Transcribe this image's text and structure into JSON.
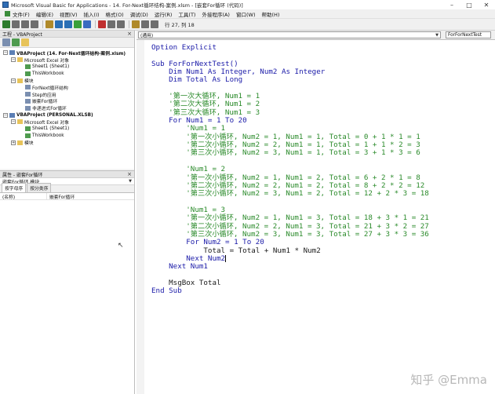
{
  "window": {
    "title": "Microsoft Visual Basic for Applications - 14. For-Next循环结构-案例.xlsm - [嵌套For循环 (代码)]",
    "minimize_glyph": "–",
    "maximize_glyph": "□",
    "close_glyph": "✕"
  },
  "menu": [
    "文件(F)",
    "编辑(E)",
    "视图(V)",
    "插入(I)",
    "格式(O)",
    "调试(D)",
    "运行(R)",
    "工具(T)",
    "外接程序(A)",
    "窗口(W)",
    "帮助(H)"
  ],
  "toolbar": {
    "position_text": "行 27, 列 18",
    "colors": [
      "#2d7c2d",
      "#6e6e6e",
      "#6e6e6e",
      "#6e6e6e",
      "#b08a2a",
      "#2a6fb5",
      "#2a6fb5",
      "#3aa03a",
      "#3a6bc0",
      "#c03030",
      "#6e6e6e",
      "#6e6e6e",
      "#b08a2a",
      "#6e6e6e",
      "#6e6e6e"
    ]
  },
  "project_panel": {
    "title": "工程 - VBAProject",
    "close_glyph": "×",
    "tree": [
      {
        "level": 0,
        "toggle": "−",
        "icon": "proj",
        "label": "VBAProject (14. For-Next循环结构-案例.xlsm)"
      },
      {
        "level": 1,
        "toggle": "−",
        "icon": "folder",
        "label": "Microsoft Excel 对象"
      },
      {
        "level": 2,
        "toggle": "",
        "icon": "sheet",
        "label": "Sheet1 (Sheet1)"
      },
      {
        "level": 2,
        "toggle": "",
        "icon": "sheet",
        "label": "ThisWorkbook"
      },
      {
        "level": 1,
        "toggle": "−",
        "icon": "folder",
        "label": "模块"
      },
      {
        "level": 2,
        "toggle": "",
        "icon": "module",
        "label": "ForNext循环结构"
      },
      {
        "level": 2,
        "toggle": "",
        "icon": "module",
        "label": "Step的应用"
      },
      {
        "level": 2,
        "toggle": "",
        "icon": "module",
        "label": "嵌套For循环"
      },
      {
        "level": 2,
        "toggle": "",
        "icon": "module",
        "label": "非递进式For循环"
      },
      {
        "level": 0,
        "toggle": "−",
        "icon": "proj",
        "label": "VBAProject (PERSONAL.XLSB)"
      },
      {
        "level": 1,
        "toggle": "−",
        "icon": "folder",
        "label": "Microsoft Excel 对象"
      },
      {
        "level": 2,
        "toggle": "",
        "icon": "sheet",
        "label": "Sheet1 (Sheet1)"
      },
      {
        "level": 2,
        "toggle": "",
        "icon": "sheet",
        "label": "ThisWorkbook"
      },
      {
        "level": 1,
        "toggle": "+",
        "icon": "folder",
        "label": "模块"
      }
    ]
  },
  "properties_panel": {
    "title": "属性 - 嵌套For循环",
    "close_glyph": "×",
    "object_dropdown": "嵌套For循环 模块",
    "tabs": [
      "按字母序",
      "按分类序"
    ],
    "rows": [
      {
        "name": "(名称)",
        "value": "嵌套For循环"
      }
    ]
  },
  "code_window": {
    "object_combo": "(通用)",
    "procedure_combo": "ForForNextTest",
    "lines": [
      {
        "text": "Option Explicit",
        "style": "kw"
      },
      {
        "text": "",
        "style": ""
      },
      {
        "text": "Sub ForForNextTest()",
        "style": "kw"
      },
      {
        "text": "    Dim Num1 As Integer, Num2 As Integer",
        "style": "kw"
      },
      {
        "text": "    Dim Total As Long",
        "style": "kw"
      },
      {
        "text": "",
        "style": ""
      },
      {
        "text": "    '第一次大循环, Num1 = 1",
        "style": "cm"
      },
      {
        "text": "    '第二次大循环, Num1 = 2",
        "style": "cm"
      },
      {
        "text": "    '第三次大循环, Num1 = 3",
        "style": "cm"
      },
      {
        "text": "    For Num1 = 1 To 20",
        "style": "kw"
      },
      {
        "text": "        'Num1 = 1",
        "style": "cm"
      },
      {
        "text": "        '第一次小循环, Num2 = 1, Num1 = 1, Total = 0 + 1 * 1 = 1",
        "style": "cm"
      },
      {
        "text": "        '第二次小循环, Num2 = 2, Num1 = 1, Total = 1 + 1 * 2 = 3",
        "style": "cm"
      },
      {
        "text": "        '第三次小循环, Num2 = 3, Num1 = 1, Total = 3 + 1 * 3 = 6",
        "style": "cm"
      },
      {
        "text": "",
        "style": ""
      },
      {
        "text": "        'Num1 = 2",
        "style": "cm"
      },
      {
        "text": "        '第一次小循环, Num2 = 1, Num1 = 2, Total = 6 + 2 * 1 = 8",
        "style": "cm"
      },
      {
        "text": "        '第二次小循环, Num2 = 2, Num1 = 2, Total = 8 + 2 * 2 = 12",
        "style": "cm"
      },
      {
        "text": "        '第三次小循环, Num2 = 3, Num1 = 2, Total = 12 + 2 * 3 = 18",
        "style": "cm"
      },
      {
        "text": "",
        "style": ""
      },
      {
        "text": "        'Num1 = 3",
        "style": "cm"
      },
      {
        "text": "        '第一次小循环, Num2 = 1, Num1 = 3, Total = 18 + 3 * 1 = 21",
        "style": "cm"
      },
      {
        "text": "        '第二次小循环, Num2 = 2, Num1 = 3, Total = 21 + 3 * 2 = 27",
        "style": "cm"
      },
      {
        "text": "        '第三次小循环, Num2 = 3, Num1 = 3, Total = 27 + 3 * 3 = 36",
        "style": "cm"
      },
      {
        "text": "        For Num2 = 1 To 20",
        "style": "kw"
      },
      {
        "text": "            Total = Total + Num1 * Num2",
        "style": ""
      },
      {
        "text": "        Next Num2",
        "style": "kw",
        "caret": true
      },
      {
        "text": "    Next Num1",
        "style": "kw"
      },
      {
        "text": "",
        "style": ""
      },
      {
        "text": "    MsgBox Total",
        "style": ""
      },
      {
        "text": "End Sub",
        "style": "kw"
      }
    ]
  },
  "watermark": "知乎 @Emma"
}
